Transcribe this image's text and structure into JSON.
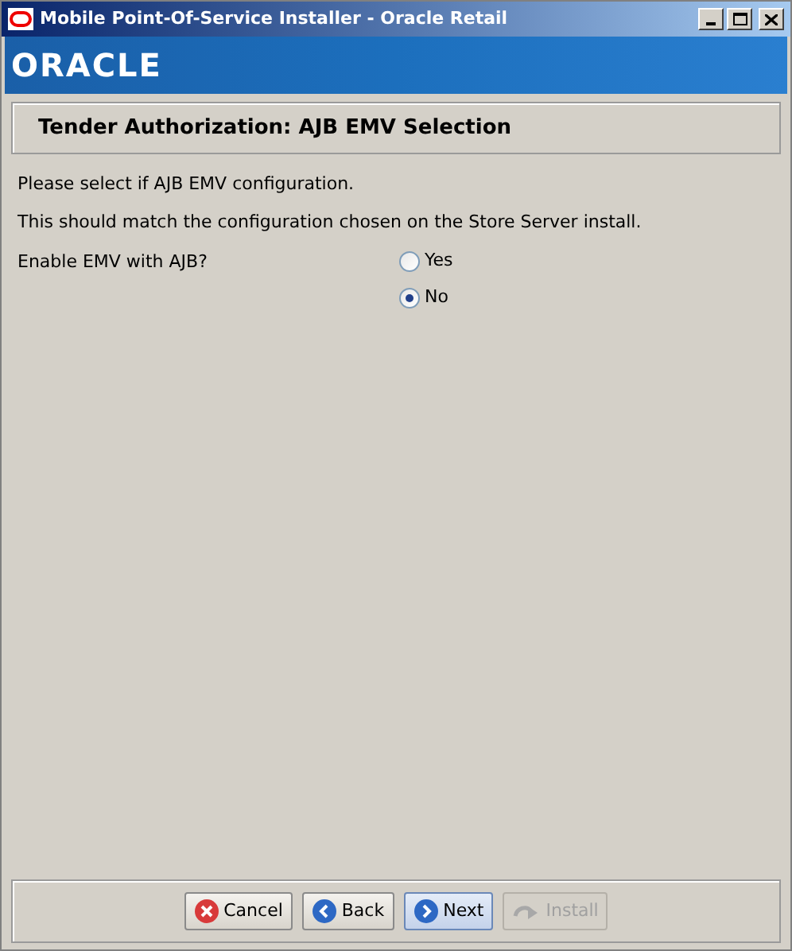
{
  "window": {
    "title": "Mobile Point-Of-Service Installer - Oracle Retail"
  },
  "banner": {
    "logo": "ORACLE"
  },
  "header": {
    "title": "Tender Authorization: AJB EMV Selection"
  },
  "instructions": [
    "Please select if AJB EMV configuration.",
    "This should match the configuration chosen on the Store Server install."
  ],
  "question": {
    "label": "Enable EMV with AJB?",
    "options": [
      {
        "label": "Yes",
        "selected": false
      },
      {
        "label": "No",
        "selected": true
      }
    ]
  },
  "buttons": [
    {
      "kind": "cancel",
      "label": "Cancel",
      "disabled": false,
      "default": false
    },
    {
      "kind": "back",
      "label": "Back",
      "disabled": false,
      "default": false
    },
    {
      "kind": "next",
      "label": "Next",
      "disabled": false,
      "default": true
    },
    {
      "kind": "install",
      "label": "Install",
      "disabled": true,
      "default": false
    }
  ]
}
